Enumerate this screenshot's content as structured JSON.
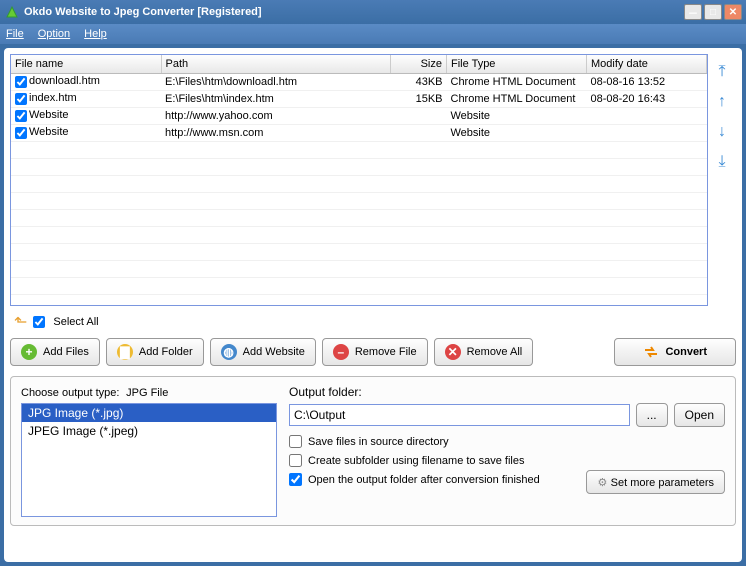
{
  "window": {
    "title": "Okdo Website to Jpeg Converter [Registered]"
  },
  "menu": {
    "file": "File",
    "option": "Option",
    "help": "Help"
  },
  "table": {
    "headers": {
      "name": "File name",
      "path": "Path",
      "size": "Size",
      "type": "File Type",
      "date": "Modify date"
    },
    "rows": [
      {
        "name": "downloadl.htm",
        "path": "E:\\Files\\htm\\downloadl.htm",
        "size": "43KB",
        "type": "Chrome HTML Document",
        "date": "08-08-16 13:52"
      },
      {
        "name": "index.htm",
        "path": "E:\\Files\\htm\\index.htm",
        "size": "15KB",
        "type": "Chrome HTML Document",
        "date": "08-08-20 16:43"
      },
      {
        "name": "Website",
        "path": "http://www.yahoo.com",
        "size": "",
        "type": "Website",
        "date": ""
      },
      {
        "name": "Website",
        "path": "http://www.msn.com",
        "size": "",
        "type": "Website",
        "date": ""
      }
    ]
  },
  "selectall": "Select All",
  "buttons": {
    "addfiles": "Add Files",
    "addfolder": "Add Folder",
    "addwebsite": "Add Website",
    "removefile": "Remove File",
    "removeall": "Remove All",
    "convert": "Convert"
  },
  "output": {
    "typelabel": "Choose output type:",
    "typecurrent": "JPG File",
    "types": {
      "jpg": "JPG Image (*.jpg)",
      "jpeg": "JPEG Image (*.jpeg)"
    },
    "folderlabel": "Output folder:",
    "foldervalue": "C:\\Output",
    "browse": "...",
    "open": "Open",
    "cb1": "Save files in source directory",
    "cb2": "Create subfolder using filename to save files",
    "cb3": "Open the output folder after conversion finished",
    "more": "Set more parameters"
  }
}
